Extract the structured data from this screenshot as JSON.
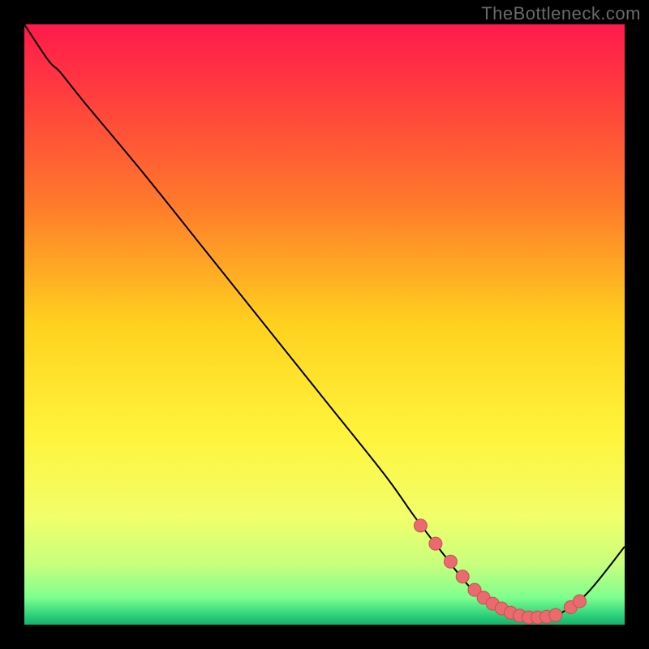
{
  "watermark": "TheBottleneck.com",
  "colors": {
    "frame": "#000000",
    "watermark": "#6a6a6a",
    "curve": "#000000",
    "marker_fill": "#ea6a6e",
    "marker_stroke": "#c84f55",
    "gradient_stops": [
      {
        "offset": 0.0,
        "color": "#ff1a4c"
      },
      {
        "offset": 0.12,
        "color": "#ff3e3e"
      },
      {
        "offset": 0.3,
        "color": "#ff7a2b"
      },
      {
        "offset": 0.5,
        "color": "#ffd21f"
      },
      {
        "offset": 0.68,
        "color": "#fff33a"
      },
      {
        "offset": 0.82,
        "color": "#f2ff6a"
      },
      {
        "offset": 0.9,
        "color": "#c7ff7d"
      },
      {
        "offset": 0.955,
        "color": "#7dff8e"
      },
      {
        "offset": 0.985,
        "color": "#2bd07a"
      },
      {
        "offset": 1.0,
        "color": "#17b06a"
      }
    ]
  },
  "chart_data": {
    "type": "line",
    "title": "",
    "xlabel": "",
    "ylabel": "",
    "xlim": [
      0,
      100
    ],
    "ylim": [
      0,
      100
    ],
    "grid": false,
    "legend": false,
    "series": [
      {
        "name": "curve",
        "x": [
          0,
          4,
          6,
          10,
          20,
          30,
          40,
          50,
          60,
          65,
          70,
          74,
          78,
          82,
          86,
          88,
          90,
          94,
          100
        ],
        "y": [
          100,
          94,
          92,
          87,
          75,
          62.5,
          50,
          37.5,
          25,
          18,
          11.5,
          6.5,
          3.3,
          1.5,
          1.2,
          1.5,
          2.3,
          5.5,
          13
        ]
      }
    ],
    "markers": {
      "name": "highlight-points",
      "x": [
        66,
        68.5,
        71,
        73,
        75,
        76.5,
        78,
        79.5,
        81,
        82.5,
        84,
        85.5,
        87,
        88.5,
        91,
        92.5
      ],
      "y": [
        16.5,
        13.5,
        10.5,
        8,
        5.8,
        4.5,
        3.5,
        2.7,
        2,
        1.5,
        1.2,
        1.2,
        1.3,
        1.6,
        2.9,
        3.9
      ]
    }
  }
}
